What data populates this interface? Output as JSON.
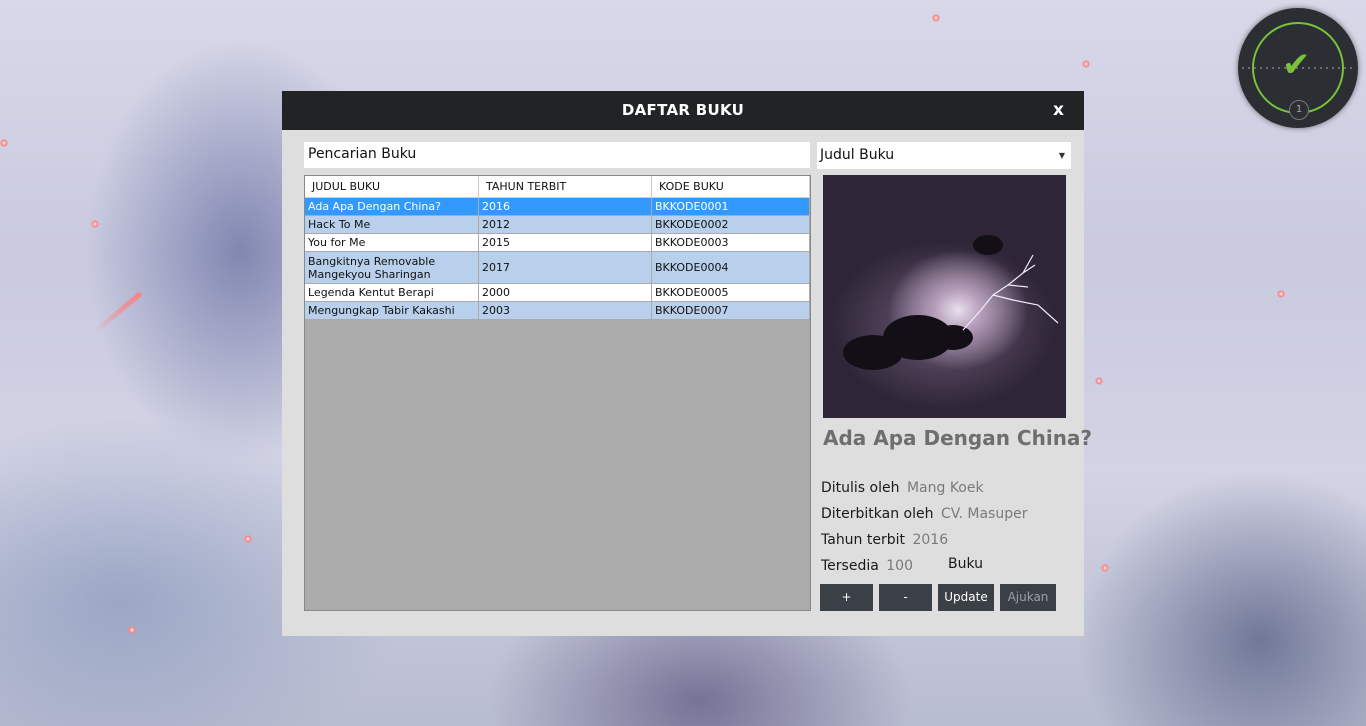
{
  "widget": {
    "check_icon": "check-icon",
    "count": "1",
    "accent": "#7ac13c"
  },
  "dialog": {
    "title": "DAFTAR BUKU",
    "close_label": "x",
    "search": {
      "value": "Pencarian Buku"
    },
    "filter": {
      "selected": "Judul Buku"
    },
    "table": {
      "headers": [
        "JUDUL BUKU",
        "TAHUN TERBIT",
        "KODE BUKU"
      ],
      "rows": [
        [
          "Ada Apa Dengan China?",
          "2016",
          "BKKODE0001"
        ],
        [
          "Hack To Me",
          "2012",
          "BKKODE0002"
        ],
        [
          "You for Me",
          "2015",
          "BKKODE0003"
        ],
        [
          "Bangkitnya Removable Mangekyou Sharingan",
          "2017",
          "BKKODE0004"
        ],
        [
          "Legenda Kentut Berapi",
          "2000",
          "BKKODE0005"
        ],
        [
          "Mengungkap Tabir Kakashi",
          "2003",
          "BKKODE0007"
        ]
      ],
      "selected_row": 0,
      "selection_color": "#3399ff",
      "alt_row_color": "#b9d0ec"
    },
    "detail": {
      "title": "Ada Apa Dengan China?",
      "author_label": "Ditulis oleh",
      "author": "Mang Koek",
      "publisher_label": "Diterbitkan oleh",
      "publisher": "CV. Masuper",
      "year_label": "Tahun terbit",
      "year": "2016",
      "stock_label": "Tersedia",
      "stock": "100",
      "stock_unit": "Buku"
    },
    "buttons": {
      "plus": "+",
      "minus": "-",
      "update": "Update",
      "submit": "Ajukan"
    }
  }
}
